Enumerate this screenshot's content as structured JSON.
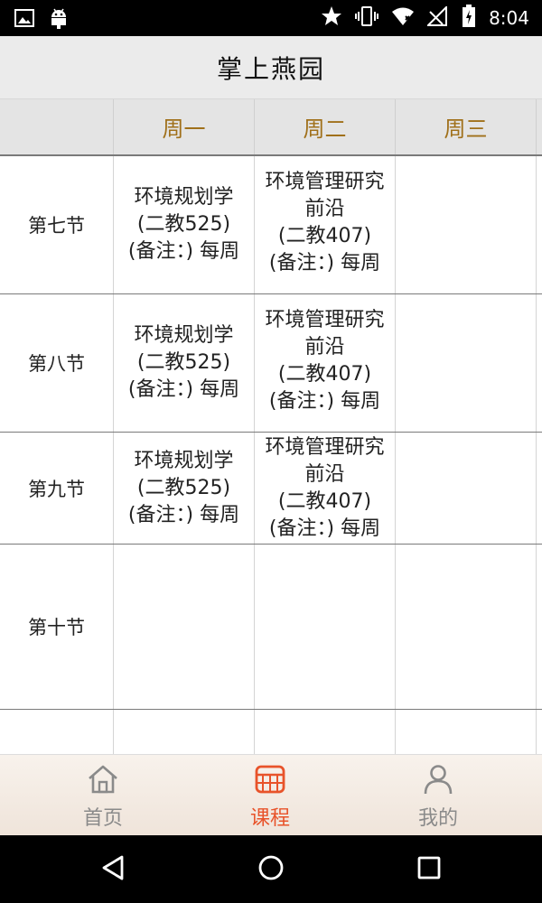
{
  "status_bar": {
    "time": "8:04",
    "icons": [
      "image-icon",
      "android-icon",
      "star-icon",
      "vibrate-icon",
      "wifi-icon",
      "no-signal-icon",
      "battery-icon"
    ]
  },
  "app_title": "掌上燕园",
  "schedule": {
    "days": [
      "周一",
      "周二",
      "周三"
    ],
    "periods": [
      {
        "label": "第七节",
        "mon": [
          "环境规划学",
          "(二教525)",
          "(备注：) 每周"
        ],
        "tue": [
          "环境管理研究",
          "前沿",
          "(二教407)",
          "(备注：) 每周"
        ],
        "wed": []
      },
      {
        "label": "第八节",
        "mon": [
          "环境规划学",
          "(二教525)",
          "(备注：) 每周"
        ],
        "tue": [
          "环境管理研究",
          "前沿",
          "(二教407)",
          "(备注：) 每周"
        ],
        "wed": []
      },
      {
        "label": "第九节",
        "mon": [
          "环境规划学",
          "(二教525)",
          "(备注：) 每周"
        ],
        "tue": [
          "环境管理研究",
          "前沿",
          "(二教407)",
          "(备注：) 每周"
        ],
        "wed": []
      },
      {
        "label": "第十节",
        "mon": [],
        "tue": [],
        "wed": []
      }
    ]
  },
  "bottom_nav": {
    "items": [
      {
        "label": "首页",
        "icon": "home-icon"
      },
      {
        "label": "课程",
        "icon": "calendar-grid-icon"
      },
      {
        "label": "我的",
        "icon": "person-icon"
      }
    ],
    "active_index": 1,
    "active_color": "#e8532a",
    "inactive_color": "#8a8a8a"
  },
  "colors": {
    "day_header": "#a0701a",
    "title_bar_bg": "#ebebeb"
  }
}
